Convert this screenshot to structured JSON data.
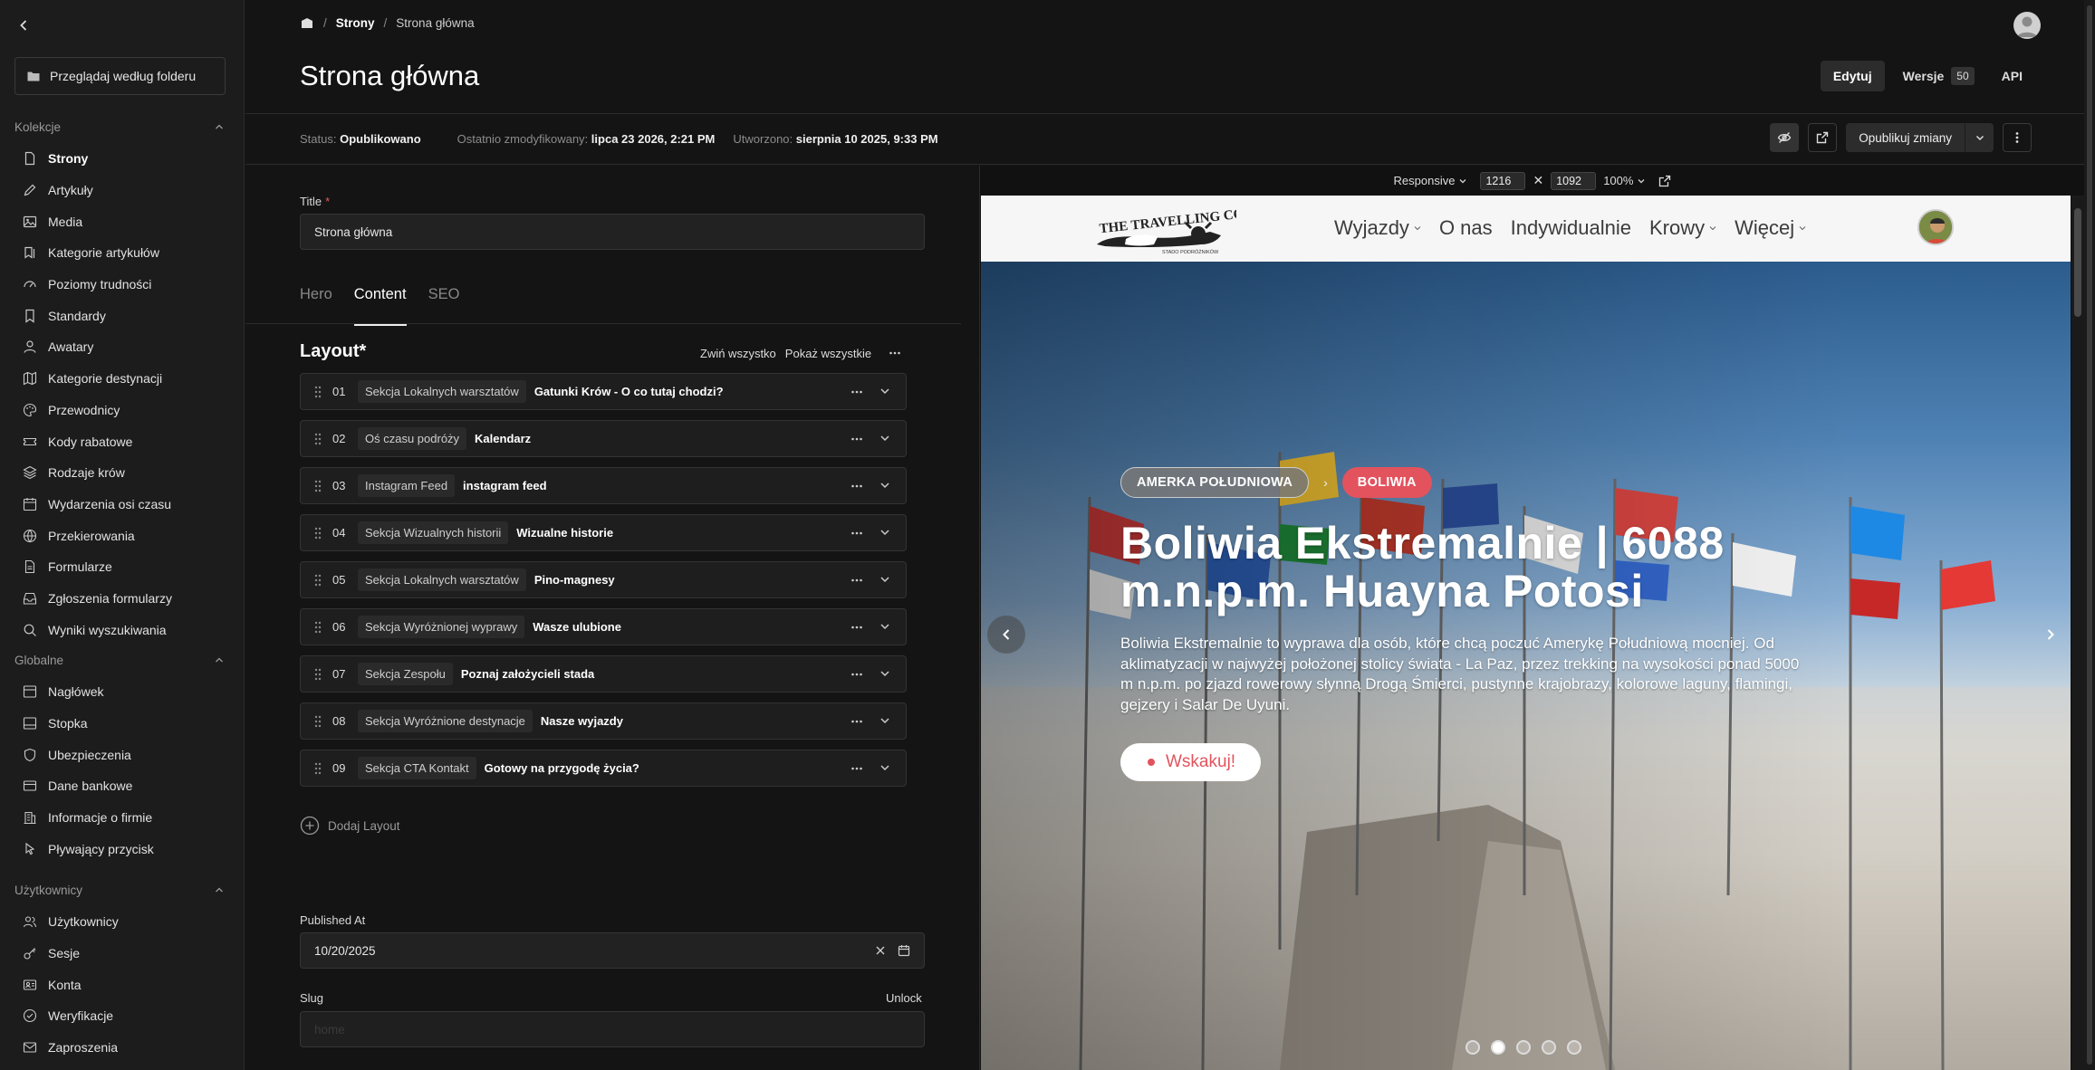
{
  "sidebar": {
    "browse_label": "Przeglądaj według folderu",
    "groups": [
      {
        "title": "Kolekcje",
        "items": [
          {
            "label": "Strony",
            "icon": "page-icon"
          },
          {
            "label": "Artykuły",
            "icon": "pen-icon"
          },
          {
            "label": "Media",
            "icon": "image-icon"
          },
          {
            "label": "Kategorie artykułów",
            "icon": "bookmarks-icon"
          },
          {
            "label": "Poziomy trudności",
            "icon": "gauge-icon"
          },
          {
            "label": "Standardy",
            "icon": "bookmark-icon"
          },
          {
            "label": "Awatary",
            "icon": "user-icon"
          },
          {
            "label": "Kategorie destynacji",
            "icon": "map-icon"
          },
          {
            "label": "Przewodnicy",
            "icon": "palette-icon"
          },
          {
            "label": "Kody rabatowe",
            "icon": "ticket-icon"
          },
          {
            "label": "Rodzaje krów",
            "icon": "layers-icon"
          },
          {
            "label": "Wydarzenia osi czasu",
            "icon": "calendar-icon"
          },
          {
            "label": "Przekierowania",
            "icon": "globe-icon"
          },
          {
            "label": "Formularze",
            "icon": "document-icon"
          },
          {
            "label": "Zgłoszenia formularzy",
            "icon": "inbox-icon"
          },
          {
            "label": "Wyniki wyszukiwania",
            "icon": "search-icon"
          }
        ]
      },
      {
        "title": "Globalne",
        "items": [
          {
            "label": "Nagłówek",
            "icon": "panel-top-icon"
          },
          {
            "label": "Stopka",
            "icon": "panel-bottom-icon"
          },
          {
            "label": "Ubezpieczenia",
            "icon": "shield-icon"
          },
          {
            "label": "Dane bankowe",
            "icon": "credit-card-icon"
          },
          {
            "label": "Informacje o firmie",
            "icon": "building-icon"
          },
          {
            "label": "Pływający przycisk",
            "icon": "pointer-icon"
          }
        ]
      },
      {
        "title": "Użytkownicy",
        "items": [
          {
            "label": "Użytkownicy",
            "icon": "users-icon"
          },
          {
            "label": "Sesje",
            "icon": "key-icon"
          },
          {
            "label": "Konta",
            "icon": "account-icon"
          },
          {
            "label": "Weryfikacje",
            "icon": "badge-check-icon"
          },
          {
            "label": "Zaproszenia",
            "icon": "mail-icon"
          }
        ]
      }
    ]
  },
  "header": {
    "breadcrumb": [
      "Strony",
      "Strona główna"
    ],
    "title": "Strona główna",
    "edit_label": "Edytuj",
    "versions_label": "Wersje",
    "versions_count": "50",
    "api_label": "API"
  },
  "status": {
    "status_label": "Status:",
    "status_value": "Opublikowano",
    "modified_label": "Ostatnio zmodyfikowany:",
    "modified_value": "lipca 23 2026, 2:21 PM",
    "created_label": "Utworzono:",
    "created_value": "sierpnia 10 2025, 9:33 PM",
    "publish_label": "Opublikuj zmiany"
  },
  "form": {
    "title_label": "Title",
    "title_required": "*",
    "title_value": "Strona główna",
    "tabs": [
      "Hero",
      "Content",
      "SEO"
    ],
    "active_tab": "Content",
    "layout_title": "Layout*",
    "collapse_all": "Zwiń wszystko",
    "show_all": "Pokaż wszystkie",
    "layouts": [
      {
        "num": "01",
        "type": "Sekcja Lokalnych warsztatów",
        "name": "Gatunki Krów - O co tutaj chodzi?"
      },
      {
        "num": "02",
        "type": "Oś czasu podróży",
        "name": "Kalendarz"
      },
      {
        "num": "03",
        "type": "Instagram Feed",
        "name": "instagram feed"
      },
      {
        "num": "04",
        "type": "Sekcja Wizualnych historii",
        "name": "Wizualne historie"
      },
      {
        "num": "05",
        "type": "Sekcja Lokalnych warsztatów",
        "name": "Pino-magnesy"
      },
      {
        "num": "06",
        "type": "Sekcja Wyróżnionej wyprawy",
        "name": "Wasze ulubione"
      },
      {
        "num": "07",
        "type": "Sekcja Zespołu",
        "name": "Poznaj założycieli stada"
      },
      {
        "num": "08",
        "type": "Sekcja Wyróżnione destynacje",
        "name": "Nasze wyjazdy"
      },
      {
        "num": "09",
        "type": "Sekcja CTA Kontakt",
        "name": "Gotowy na przygodę życia?"
      }
    ],
    "add_layout": "Dodaj Layout",
    "published_at_label": "Published At",
    "published_at_value": "10/20/2025",
    "slug_label": "Slug",
    "unlock_label": "Unlock",
    "slug_placeholder": "home"
  },
  "preview": {
    "mode": "Responsive",
    "width": "1216",
    "height": "1092",
    "zoom": "100%",
    "site": {
      "nav": [
        {
          "label": "Wyjazdy",
          "dropdown": true
        },
        {
          "label": "O nas",
          "dropdown": false
        },
        {
          "label": "Indywidualnie",
          "dropdown": false
        },
        {
          "label": "Krowy",
          "dropdown": true
        },
        {
          "label": "Więcej",
          "dropdown": true
        }
      ],
      "logo_text": "THE TRAVELLING COWS",
      "logo_sub": "STADO PODRÓŻNIKÓW",
      "chip_region": "AMERKA POŁUDNIOWA",
      "chip_country": "BOLIWIA",
      "hero_title": "Boliwia Ekstremalnie | 6088 m.n.p.m. Huayna Potosi",
      "hero_desc": "Boliwia Ekstremalnie to wyprawa dla osób, które chcą poczuć Amerykę Południową mocniej. Od aklimatyzacji w najwyżej położonej stolicy świata - La Paz, przez trekking na wysokości ponad 5000 m n.p.m. po zjazd rowerowy słynną Drogą Śmierci, pustynne krajobrazy, kolorowe laguny, flamingi, gejzery i Salar De Uyuni.",
      "cta_label": "Wskakuj!",
      "slides": 5,
      "active_slide": 2
    }
  }
}
